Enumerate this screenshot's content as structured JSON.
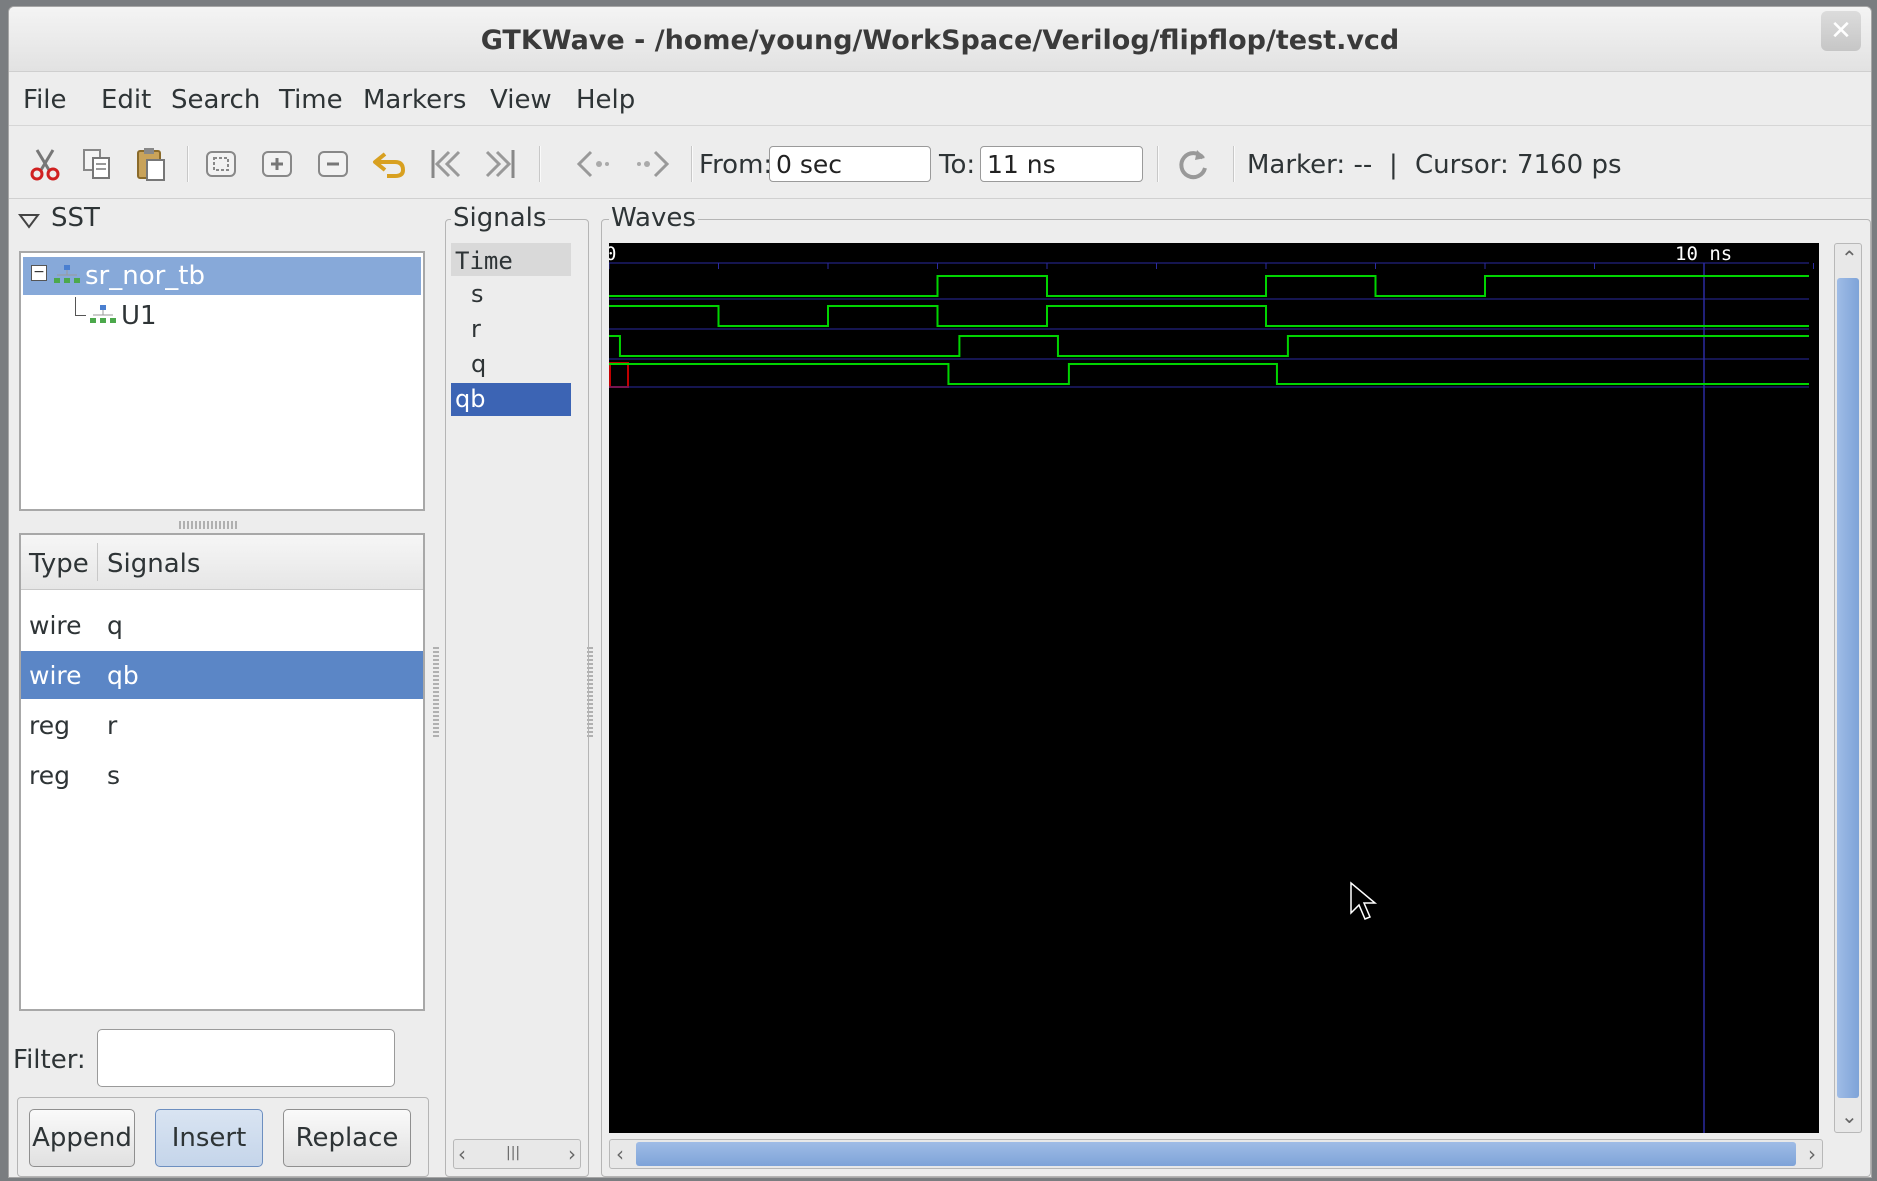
{
  "window": {
    "title": "GTKWave - /home/young/WorkSpace/Verilog/flipflop/test.vcd"
  },
  "menu": [
    "File",
    "Edit",
    "Search",
    "Time",
    "Markers",
    "View",
    "Help"
  ],
  "toolbar": {
    "from_label": "From:",
    "from_value": "0 sec",
    "to_label": "To:",
    "to_value": "11 ns",
    "marker_label": "Marker: --",
    "separator": "|",
    "cursor_label": "Cursor: 7160 ps",
    "icons": [
      "cut-icon",
      "copy-icon",
      "paste-icon",
      "zoom-fit-icon",
      "zoom-in-icon",
      "zoom-out-icon",
      "undo-zoom-icon",
      "zoom-start-icon",
      "zoom-end-icon",
      "prev-edge-icon",
      "next-edge-icon",
      "reload-icon"
    ]
  },
  "sst": {
    "title": "SST",
    "tree": [
      {
        "label": "sr_nor_tb",
        "selected": true
      },
      {
        "label": "U1",
        "selected": false
      }
    ]
  },
  "signal_list": {
    "headers": {
      "type": "Type",
      "signals": "Signals"
    },
    "rows": [
      {
        "type": "wire",
        "name": "q",
        "selected": false
      },
      {
        "type": "wire",
        "name": "qb",
        "selected": true
      },
      {
        "type": "reg",
        "name": "r",
        "selected": false
      },
      {
        "type": "reg",
        "name": "s",
        "selected": false
      }
    ]
  },
  "filter": {
    "label": "Filter:",
    "value": ""
  },
  "buttons": {
    "append": "Append",
    "insert": "Insert",
    "replace": "Replace"
  },
  "signals_pane": {
    "title": "Signals",
    "rows": [
      {
        "label": "Time",
        "selected": false
      },
      {
        "label": "s",
        "selected": false
      },
      {
        "label": "r",
        "selected": false
      },
      {
        "label": "q",
        "selected": false
      },
      {
        "label": "qb",
        "selected": true
      }
    ]
  },
  "waves": {
    "title": "Waves",
    "time_start_label": "0",
    "time_end_label": "10 ns",
    "range_ns": [
      0,
      11
    ],
    "marker_ns": 10,
    "cursor_ns": 7.16,
    "colors": {
      "wave": "#00d400",
      "grid": "#2a2aa0",
      "background": "#000000",
      "selection": "#c00000"
    },
    "signals": [
      {
        "name": "s",
        "transitions": [
          [
            0,
            0
          ],
          [
            3,
            1
          ],
          [
            4,
            0
          ],
          [
            6,
            1
          ],
          [
            7,
            0
          ],
          [
            8,
            1
          ]
        ]
      },
      {
        "name": "r",
        "transitions": [
          [
            0,
            1
          ],
          [
            1,
            0
          ],
          [
            2,
            1
          ],
          [
            3,
            0
          ],
          [
            4,
            1
          ],
          [
            6,
            0
          ]
        ]
      },
      {
        "name": "q",
        "transitions": [
          [
            0,
            1
          ],
          [
            0.1,
            0
          ],
          [
            3.2,
            1
          ],
          [
            4.1,
            0
          ],
          [
            6.2,
            1
          ]
        ]
      },
      {
        "name": "qb",
        "transitions": [
          [
            0,
            1
          ],
          [
            3.1,
            0
          ],
          [
            4.2,
            1
          ],
          [
            6.1,
            0
          ]
        ]
      }
    ]
  }
}
